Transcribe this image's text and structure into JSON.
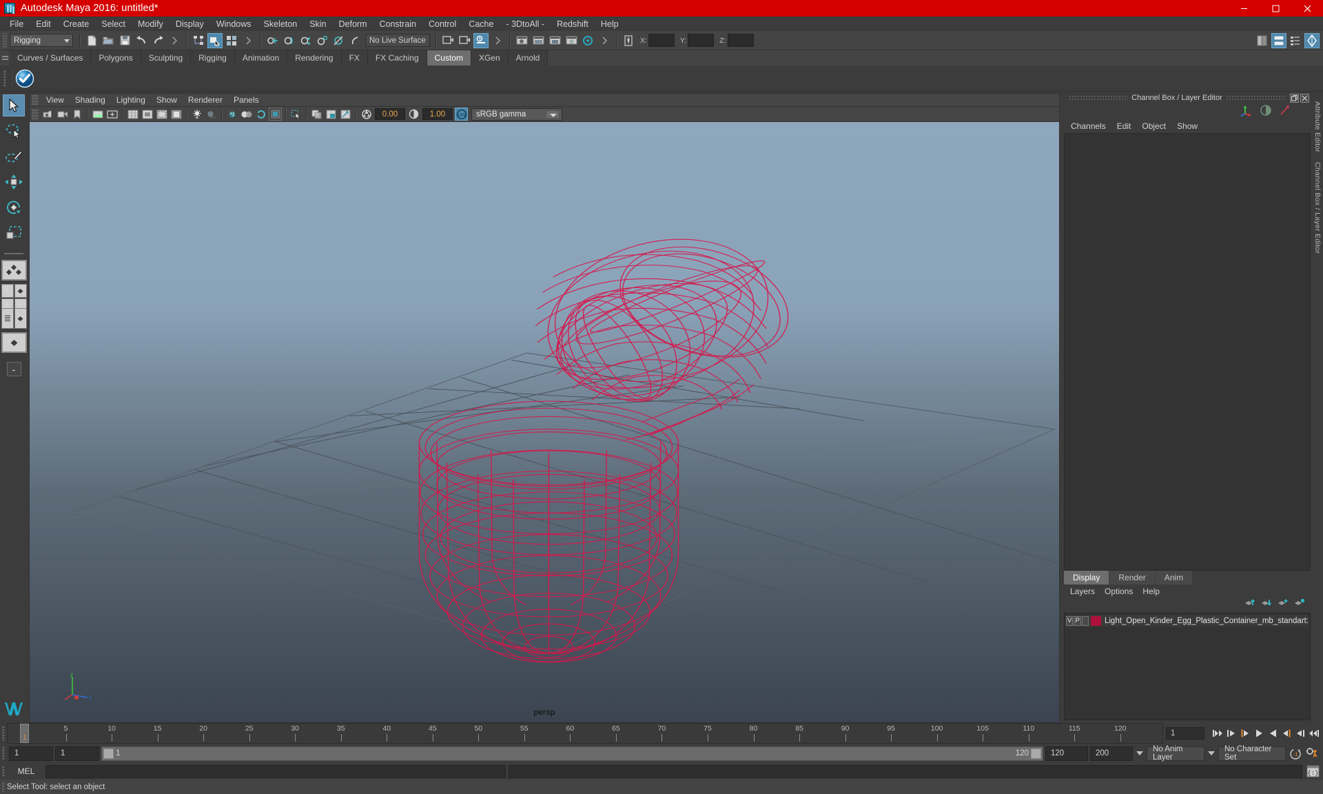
{
  "window": {
    "title": "Autodesk Maya 2016: untitled*",
    "app_icon": "maya-logo-icon",
    "minimize": "minimize-icon",
    "maximize": "maximize-icon",
    "close": "close-icon",
    "title_bar_color": "#d40000"
  },
  "menubar": {
    "items": [
      "File",
      "Edit",
      "Create",
      "Select",
      "Modify",
      "Display",
      "Windows",
      "Skeleton",
      "Skin",
      "Deform",
      "Constrain",
      "Control",
      "Cache",
      "- 3DtoAll -",
      "Redshift",
      "Help"
    ]
  },
  "statusbar": {
    "mode": "Rigging",
    "live_surface": "No Live Surface",
    "coord_labels": {
      "x": "X:",
      "y": "Y:",
      "z": "Z:"
    },
    "coord_values": {
      "x": "",
      "y": "",
      "z": ""
    }
  },
  "shelf": {
    "tabs": [
      "Curves / Surfaces",
      "Polygons",
      "Sculpting",
      "Rigging",
      "Animation",
      "Rendering",
      "FX",
      "FX Caching",
      "Custom",
      "XGen",
      "Arnold"
    ],
    "active_tab": "Custom"
  },
  "viewport": {
    "menus": [
      "View",
      "Shading",
      "Lighting",
      "Show",
      "Renderer",
      "Panels"
    ],
    "exposure": "0.00",
    "gamma": "1.00",
    "color_management": "sRGB gamma",
    "camera_label": "persp",
    "model_color": "#d6174b",
    "sky_top": "#8fa7bd",
    "sky_bottom": "#3b4450"
  },
  "channelbox": {
    "panel_title": "Channel Box / Layer Editor",
    "menus": [
      "Channels",
      "Edit",
      "Object",
      "Show"
    ]
  },
  "attribute_editor": {
    "vertical_label_1": "Attribute Editor",
    "vertical_label_2": "Channel Box / Layer Editor"
  },
  "layer_editor": {
    "tabs": [
      "Display",
      "Render",
      "Anim"
    ],
    "active_tab": "Display",
    "menus": [
      "Layers",
      "Options",
      "Help"
    ],
    "layers": [
      {
        "visible": "V",
        "playback": "P",
        "color": "#b0113c",
        "name": "Light_Open_Kinder_Egg_Plastic_Container_mb_standart:"
      }
    ]
  },
  "timeslider": {
    "ticks": [
      "5",
      "10",
      "15",
      "20",
      "25",
      "30",
      "35",
      "40",
      "45",
      "50",
      "55",
      "60",
      "65",
      "70",
      "75",
      "80",
      "85",
      "90",
      "95",
      "100",
      "105",
      "110",
      "115",
      "120"
    ],
    "current_frame": "1",
    "current_frame_field": "1",
    "end_label": "120",
    "transport": [
      "go-to-start-icon",
      "step-back-key-icon",
      "step-back-frame-icon",
      "play-backwards-icon",
      "play-forwards-icon",
      "step-forward-frame-icon",
      "step-forward-key-icon",
      "go-to-end-icon"
    ]
  },
  "rangeslider": {
    "anim_start": "1",
    "range_start": "1",
    "bar_left_label": "1",
    "bar_right_label": "120",
    "range_end": "120",
    "anim_end": "200",
    "anim_layer": "No Anim Layer",
    "character_set": "No Character Set"
  },
  "commandline": {
    "language": "MEL",
    "input_value": "",
    "output_value": ""
  },
  "helpline": {
    "message": "Select Tool: select an object"
  },
  "toolbox": {
    "tools": [
      "select-tool",
      "lasso-select-tool",
      "paint-select-tool",
      "move-tool",
      "rotate-tool",
      "scale-tool"
    ],
    "layouts": [
      "single-perspective-layout",
      "four-view-layout",
      "outliner-persp-layout",
      "hypergraph-persp-layout"
    ],
    "minus_label": "-"
  }
}
